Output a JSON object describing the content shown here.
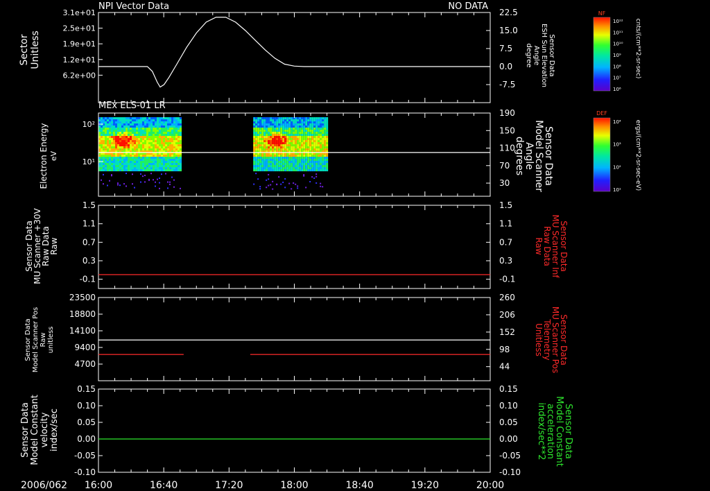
{
  "chart_data": [
    {
      "type": "line",
      "panel_title": "NPI Vector Data",
      "status_label": "NO DATA",
      "ylabel_left": [
        "Sector",
        "Unitless"
      ],
      "ylabel_right": [
        "Sensor Data",
        "ESH Sun Elevation",
        "Angle",
        "degree"
      ],
      "yticks_left": [
        "3.1e+01",
        "2.5e+01",
        "1.9e+01",
        "1.2e+01",
        "6.2e+00"
      ],
      "ylim_right": [
        -15,
        22.5
      ],
      "yticks_right": [
        "22.5",
        "15.0",
        "7.5",
        "0.0",
        "-7.5"
      ],
      "series": [
        {
          "color": "#ffffff",
          "x": [
            16.0,
            16.5,
            16.55,
            16.6,
            16.63,
            16.67,
            16.72,
            16.8,
            16.9,
            17.0,
            17.1,
            17.2,
            17.3,
            17.4,
            17.5,
            17.6,
            17.7,
            17.8,
            17.9,
            18.0,
            18.1,
            18.2,
            18.4,
            18.8,
            19.2,
            19.6,
            20.0
          ],
          "y": [
            0.0,
            0.0,
            -2.0,
            -6.5,
            -8.5,
            -7.5,
            -4.5,
            1.0,
            8.0,
            14.0,
            18.5,
            20.5,
            20.5,
            18.5,
            15.0,
            11.0,
            7.0,
            3.5,
            1.0,
            0.2,
            0.0,
            0.0,
            0.0,
            0.0,
            0.0,
            0.0,
            0.0
          ]
        }
      ],
      "colorbar": {
        "label": "NF",
        "units": "cnts/(cm**2-sr-sec)",
        "ticks": [
          "10¹²",
          "10¹¹",
          "10¹⁰",
          "10⁹",
          "10⁸",
          "10⁷",
          "10⁶"
        ]
      }
    },
    {
      "type": "heatmap",
      "panel_title": "MEx ELS-01 LR",
      "ylabel_left": [
        "Electron Energy",
        "eV"
      ],
      "ylabel_right": [
        "Sensor Data",
        "Model Scanner",
        "Angle",
        "degrees"
      ],
      "yticks_left": [
        "10²",
        "10¹"
      ],
      "ylim_right": [
        0,
        190
      ],
      "yticks_right": [
        "190",
        "150",
        "110",
        "70",
        "30"
      ],
      "data_intervals": [
        [
          16.0,
          16.83
        ],
        [
          17.58,
          18.33
        ]
      ],
      "line": {
        "color": "#ffffff",
        "value": 100
      },
      "colorbar": {
        "label": "DEF",
        "units": "ergs/(cm**2-sr-sec-eV)",
        "ticks": [
          "10⁴",
          "10³",
          "10²",
          "10¹"
        ]
      }
    },
    {
      "type": "line",
      "ylabel_left": [
        "Sensor Data",
        "MU Scanner +30V",
        "Raw Data",
        "Raw"
      ],
      "ylabel_right": [
        "Sensor Data",
        "MU Scanner Inf",
        "Raw Data",
        "Raw"
      ],
      "right_label_color": "#ff2a2a",
      "ylim": [
        -0.3,
        1.5
      ],
      "yticks_left": [
        "1.5",
        "1.1",
        "0.7",
        "0.3",
        "-0.1"
      ],
      "yticks_right": [
        "1.5",
        "1.1",
        "0.7",
        "0.3",
        "-0.1"
      ],
      "series": [
        {
          "color": "#ff2a2a",
          "x": [
            16.0,
            20.0
          ],
          "y": [
            0.0,
            0.0
          ]
        }
      ]
    },
    {
      "type": "line",
      "ylabel_left": [
        "Sensor Data",
        "Model Scanner Pos",
        "Raw",
        "unitless"
      ],
      "ylabel_right": [
        "Sensor Data",
        "MU Scanner Pos",
        "Telemetry",
        "Unitless"
      ],
      "right_label_color": "#ff2a2a",
      "ylim_left": [
        0,
        23500
      ],
      "yticks_left": [
        "23500",
        "18800",
        "14100",
        "9400",
        "4700"
      ],
      "ylim_right": [
        0,
        260
      ],
      "yticks_right": [
        "260",
        "206",
        "152",
        "98",
        "44"
      ],
      "series": [
        {
          "color": "#ffffff",
          "axis": "left",
          "x": [
            16.0,
            20.0
          ],
          "y": [
            11500,
            11500
          ]
        },
        {
          "color": "#ff2a2a",
          "axis": "right",
          "x": [
            16.0,
            16.87
          ],
          "y": [
            82,
            82
          ]
        },
        {
          "color": "#ff2a2a",
          "axis": "right",
          "x": [
            17.55,
            20.0
          ],
          "y": [
            82,
            82
          ]
        }
      ]
    },
    {
      "type": "line",
      "ylabel_left": [
        "Sensor Data",
        "Model Constant",
        "velocity",
        "index/sec"
      ],
      "ylabel_right": [
        "Sensor Data",
        "Model Constant",
        "acceleration",
        "index/sec**2"
      ],
      "right_label_color": "#2ee82e",
      "ylim": [
        -0.1,
        0.15
      ],
      "yticks_left": [
        "0.15",
        "0.10",
        "0.05",
        "0.00",
        "-0.05",
        "-0.10"
      ],
      "yticks_right": [
        "0.15",
        "0.10",
        "0.05",
        "0.00",
        "-0.05",
        "-0.10"
      ],
      "series": [
        {
          "color": "#2ee82e",
          "x": [
            16.0,
            20.0
          ],
          "y": [
            0.0,
            0.0
          ]
        }
      ]
    }
  ],
  "time_axis": {
    "date_label": "2006/062",
    "ticks": [
      "16:00",
      "16:40",
      "17:20",
      "18:00",
      "18:40",
      "19:20",
      "20:00"
    ]
  }
}
